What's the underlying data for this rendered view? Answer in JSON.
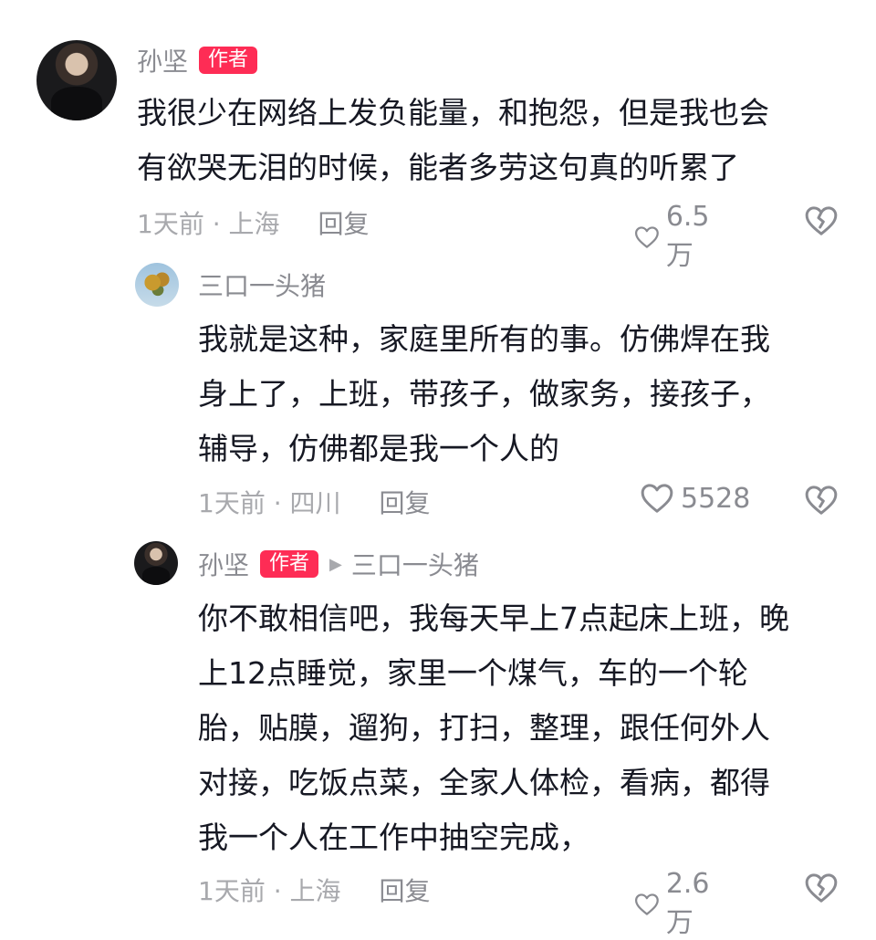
{
  "comments": [
    {
      "author": "孙坚",
      "badge": "作者",
      "text": "我很少在网络上发负能量，和抱怨，但是我也会\n有欲哭无泪的时候，能者多劳这句真的听累了",
      "time_location": "1天前 · 上海",
      "reply_label": "回复",
      "likes": "6.5万"
    },
    {
      "author": "三口一头猪",
      "text": "我就是这种，家庭里所有的事。仿佛焊在我\n身上了，上班，带孩子，做家务，接孩子，\n辅导，仿佛都是我一个人的",
      "time_location": "1天前 · 四川",
      "reply_label": "回复",
      "likes": "5528"
    },
    {
      "author": "孙坚",
      "badge": "作者",
      "reply_to": "三口一头猪",
      "text": "你不敢相信吧，我每天早上7点起床上班，晚\n上12点睡觉，家里一个煤气，车的一个轮\n胎，贴膜，遛狗，打扫，整理，跟任何外人\n对接，吃饭点菜，全家人体检，看病，都得\n我一个人在工作中抽空完成，",
      "time_location": "1天前 · 上海",
      "reply_label": "回复",
      "likes": "2.6万"
    }
  ],
  "icons": {
    "like": "heart-outline-icon",
    "dislike": "broken-heart-icon",
    "reply_arrow": "triangle-right-icon"
  },
  "colors": {
    "badge": "#fe2c55",
    "secondary_text": "#8a8b91",
    "meta_text": "#a8a9ad"
  }
}
